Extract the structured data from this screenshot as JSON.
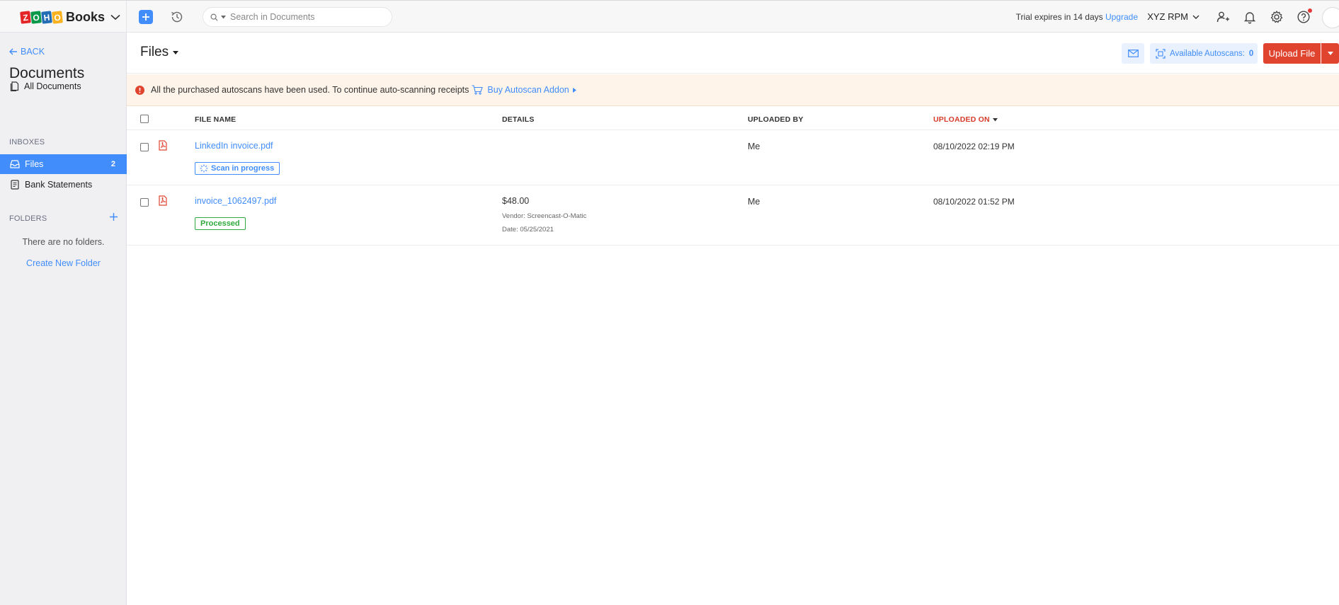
{
  "app": {
    "brand_letters": [
      "Z",
      "O",
      "H",
      "O"
    ],
    "brand_colors": [
      "#e42527",
      "#089949",
      "#226db4",
      "#f9b21d"
    ],
    "brand_name": "Books"
  },
  "topbar": {
    "search_placeholder": "Search in Documents",
    "trial_text": "Trial expires in 14 days",
    "upgrade_label": "Upgrade",
    "org_name": "XYZ RPM"
  },
  "sidebar": {
    "back_label": "BACK",
    "title": "Documents",
    "all_documents": "All Documents",
    "inboxes_heading": "INBOXES",
    "inboxes": [
      {
        "label": "Files",
        "count": "2",
        "active": true
      },
      {
        "label": "Bank Statements",
        "count": "",
        "active": false
      }
    ],
    "folders_heading": "FOLDERS",
    "no_folders_text": "There are no folders.",
    "create_folder_label": "Create New Folder"
  },
  "main": {
    "title": "Files",
    "autoscans_label": "Available Autoscans:",
    "autoscans_count": "0",
    "upload_label": "Upload File",
    "banner_text": "All the purchased autoscans have been used. To continue auto-scanning receipts",
    "banner_link": "Buy Autoscan Addon",
    "columns": {
      "file_name": "FILE NAME",
      "details": "DETAILS",
      "uploaded_by": "UPLOADED BY",
      "uploaded_on": "UPLOADED ON"
    },
    "rows": [
      {
        "file_name": "LinkedIn invoice.pdf",
        "status": "Scan in progress",
        "status_type": "scan",
        "amount": "",
        "vendor": "",
        "date": "",
        "uploaded_by": "Me",
        "uploaded_on": "08/10/2022 02:19 PM"
      },
      {
        "file_name": "invoice_1062497.pdf",
        "status": "Processed",
        "status_type": "done",
        "amount": "$48.00",
        "vendor": "Vendor: Screencast-O-Matic",
        "date": "Date: 05/25/2021",
        "uploaded_by": "Me",
        "uploaded_on": "08/10/2022 01:52 PM"
      }
    ]
  },
  "colors": {
    "accent": "#408dfb",
    "primary_button": "#e0442f",
    "banner_bg": "#fef4ea",
    "processed": "#31a93f",
    "sort_active": "#d63b2a"
  }
}
